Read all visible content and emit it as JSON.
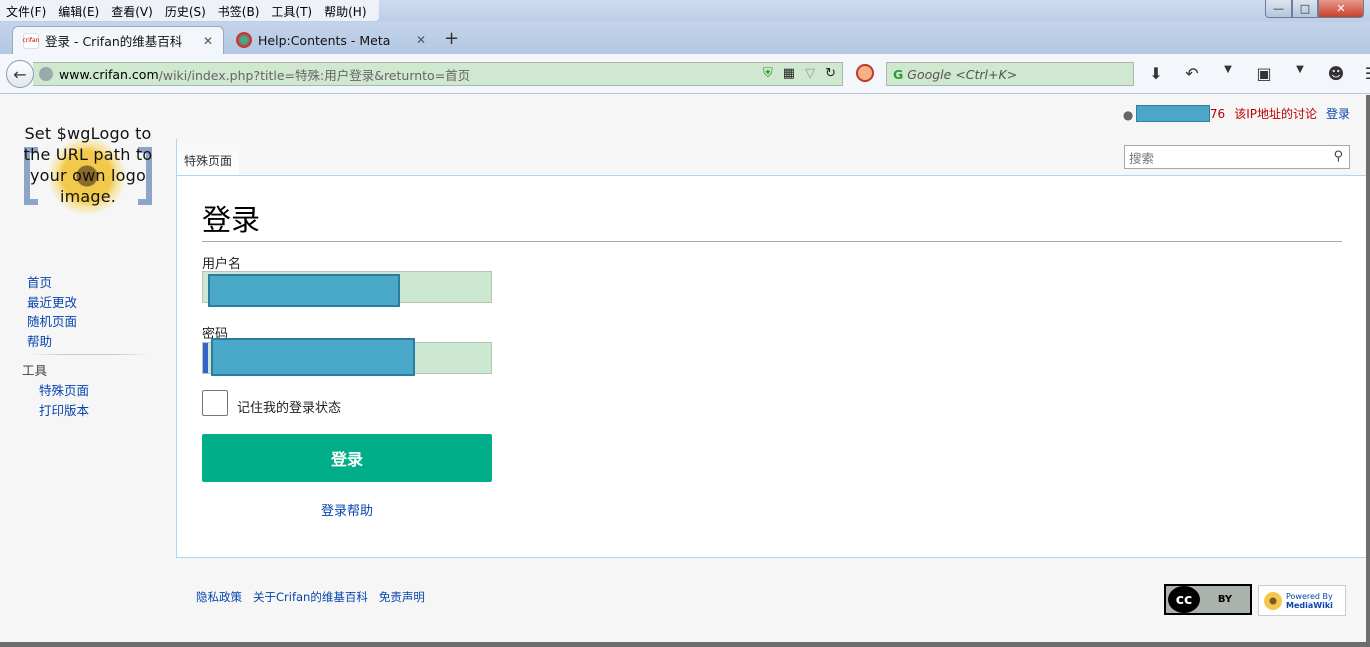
{
  "browser": {
    "menu": [
      "文件(F)",
      "编辑(E)",
      "查看(V)",
      "历史(S)",
      "书签(B)",
      "工具(T)",
      "帮助(H)"
    ],
    "tabs": [
      {
        "title": "登录 - Crifan的维基百科",
        "favicon": "crifan"
      },
      {
        "title": "Help:Contents - Meta"
      }
    ],
    "url": {
      "host": "www.crifan.com",
      "path": "/wiki/index.php?title=特殊:用户登录&returnto=首页"
    },
    "search_placeholder": "Google <Ctrl+K>",
    "new_tab": "+"
  },
  "personal": {
    "username_suffix": "76",
    "talk": "该IP地址的讨论",
    "login": "登录"
  },
  "logo": {
    "text": "Set $wgLogo to the URL path to your own logo image."
  },
  "sidebar": {
    "nav": [
      "首页",
      "最近更改",
      "随机页面",
      "帮助"
    ],
    "tools_heading": "工具",
    "tools": [
      "特殊页面",
      "打印版本"
    ]
  },
  "page_tab": "特殊页面",
  "search": {
    "placeholder": "搜索"
  },
  "content": {
    "title": "登录",
    "username_label": "用户名",
    "password_label": "密码",
    "remember_label": "记住我的登录状态",
    "submit": "登录",
    "help": "登录帮助"
  },
  "footer": {
    "links": [
      "隐私政策",
      "关于Crifan的维基百科",
      "免责声明"
    ],
    "cc_label": "BY",
    "mw_label": [
      "Powered By",
      "MediaWiki"
    ]
  },
  "colors": {
    "accent": "#00af89",
    "link": "#0645ad",
    "redlink": "#ba0000",
    "redaction": "#4aa8c9"
  }
}
